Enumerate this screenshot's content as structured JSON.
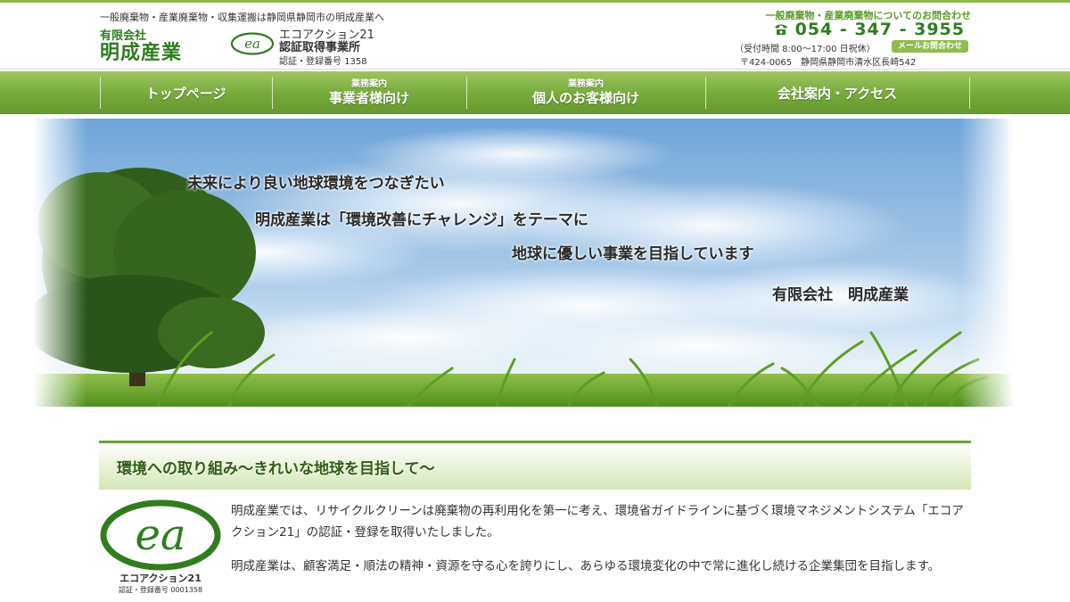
{
  "header": {
    "tagline": "一般廃棄物・産業廃棄物・収集運搬は静岡県静岡市の明成産業へ",
    "company_kind": "有限会社",
    "company_name": "明成産業",
    "ea_logo_text": "ea",
    "ea_title": "エコアクション21",
    "ea_subtitle": "認証取得事業所",
    "ea_number": "認証・登録番号 1358",
    "contact_heading": "一般廃棄物・産業廃棄物についてのお問合わせ",
    "phone": "054 - 347 - 3955",
    "hours": "（受付時間 8:00～17:00 日祝休）",
    "mail_button": "メールお問合わせ",
    "address": "〒424-0065　静岡県静岡市清水区長崎542"
  },
  "nav": {
    "items": [
      {
        "small": "",
        "label": "トップページ"
      },
      {
        "small": "業務案内",
        "label": "事業者様向け"
      },
      {
        "small": "業務案内",
        "label": "個人のお客様向け"
      },
      {
        "small": "",
        "label": "会社案内・アクセス"
      }
    ]
  },
  "hero": {
    "lines": [
      "未来により良い地球環境をつなぎたい",
      "明成産業は「環境改善にチャレンジ」をテーマに",
      "地球に優しい事業を目指しています",
      "有限会社　明成産業"
    ]
  },
  "section": {
    "title": "環境への取り組み～きれいな地球を目指して～",
    "ea_logo_text": "ea",
    "ea_name": "エコアクション21",
    "ea_number": "認証・登録番号 0001358",
    "paragraphs": [
      "明成産業では、リサイクルクリーンは廃棄物の再利用化を第一に考え、環境省ガイドラインに基づく環境マネジメントシステム「エコアクション21」の認証・登録を取得いたしました。",
      "明成産業は、顧客満足・順法の精神・資源を守る心を誇りにし、あらゆる環境変化の中で常に進化し続ける企業集団を目指します。"
    ]
  },
  "colors": {
    "brand_green": "#2f7d1f",
    "nav_green": "#76a93b",
    "accent_green": "#6aa236"
  }
}
